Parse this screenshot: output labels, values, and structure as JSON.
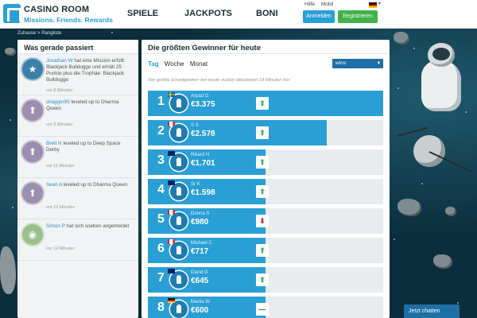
{
  "header": {
    "logo_name": "CASINO ROOM",
    "logo_tag": "Missions. Friends. Rewards",
    "nav": [
      "SPIELE",
      "JACKPOTS",
      "BONI"
    ],
    "mini_links": [
      "Hilfe",
      "Mobil"
    ],
    "login_label": "Anmelden",
    "register_label": "Registrieren",
    "language_flag": "de"
  },
  "breadcrumb": "Zuhause > Rangliste",
  "feed": {
    "title": "Was gerade passiert",
    "items": [
      {
        "user": "Jonathan W",
        "text": " hat eine Mission erfüllt: Blackjack Bulldogge und erhält 25 Punkte plus die Trophäe: Blackjack Bulldogge",
        "time": "vor 8 Minuten",
        "badge": "star-icon"
      },
      {
        "user": "shagger85",
        "text": " leveled up to Dharma Queen",
        "time": "vor 9 Minuten",
        "badge": "arrow-up-icon"
      },
      {
        "user": "Brett N",
        "text": " leveled up to Deep Space Derby",
        "time": "vor 11 Minuten",
        "badge": "arrow-up-icon"
      },
      {
        "user": "Sean A",
        "text": " leveled up to Dharma Queen",
        "time": "vor 12 Minuten",
        "badge": "arrow-up-icon"
      },
      {
        "user": "Simon P",
        "text": " hat sich soeben angemeldet",
        "time": "vor 12 Minuten",
        "badge": "alien-icon"
      }
    ]
  },
  "leaderboard": {
    "title": "Die größten Gewinner für heute",
    "tabs": [
      "Tag",
      "Woche",
      "Monat"
    ],
    "active_tab": "Tag",
    "select_value": "wins",
    "info": "Der größte Einzelgewinn von heute zuletzt aktualisiert 18 Minuten her.",
    "rows": [
      {
        "rank": "1",
        "name": "Arpad G",
        "amount": "€3.375",
        "trend": "up",
        "flag": "se",
        "fill": 1.0
      },
      {
        "rank": "2",
        "name": "S S",
        "amount": "€2.578",
        "trend": "up",
        "flag": "ca",
        "fill": 0.76
      },
      {
        "rank": "3",
        "name": "Rikard H",
        "amount": "€1.701",
        "trend": "up",
        "flag": "au",
        "fill": 0.5
      },
      {
        "rank": "4",
        "name": "Sr K",
        "amount": "€1.598",
        "trend": "up",
        "flag": "au",
        "fill": 0.47
      },
      {
        "rank": "5",
        "name": "Donna S",
        "amount": "€980",
        "trend": "down",
        "flag": "ca",
        "fill": 0.29
      },
      {
        "rank": "6",
        "name": "Michael C",
        "amount": "€717",
        "trend": "up",
        "flag": "ca",
        "fill": 0.21
      },
      {
        "rank": "7",
        "name": "David G",
        "amount": "€645",
        "trend": "up",
        "flag": "au",
        "fill": 0.19
      },
      {
        "rank": "8",
        "name": "Marita W",
        "amount": "€600",
        "trend": "same",
        "flag": "de",
        "fill": 0.18
      }
    ]
  },
  "chat_label": "Jetzt chatten",
  "colors": {
    "accent": "#2a9fd6",
    "success": "#3fb24a",
    "space": "#0b2d3c"
  }
}
